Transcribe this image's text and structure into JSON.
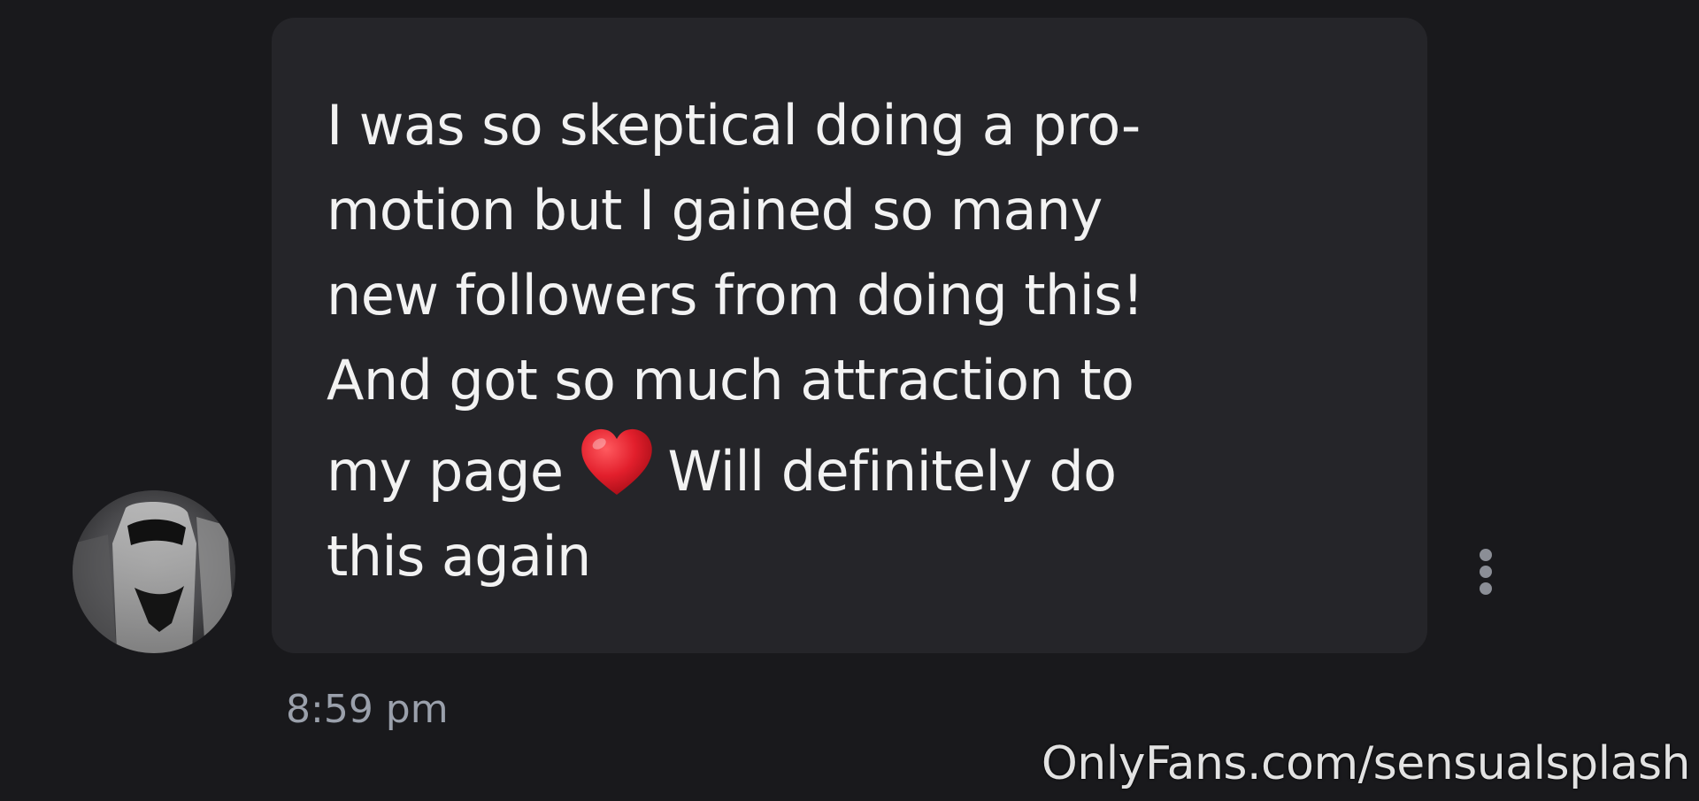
{
  "chat": {
    "avatar": {
      "icon": "user-avatar-photo"
    },
    "message": {
      "text_before_emoji": "I was so skeptical doing a pro-\nmotion but I gained so many\nnew followers from doing this!\nAnd got so much attraction to\nmy page",
      "emoji": "red-heart-emoji",
      "text_after_emoji": "Will definitely do\nthis again",
      "timestamp": "8:59 pm"
    },
    "more_button": {
      "icon": "more-vertical-icon"
    }
  },
  "watermark": {
    "text": "OnlyFans.com/sensualsplash"
  },
  "colors": {
    "background": "#19191c",
    "bubble": "#252529",
    "text": "#f2f2f2",
    "timestamp": "#9aa0ab",
    "icon": "#8b8e96",
    "heart": "#e21f2c"
  }
}
